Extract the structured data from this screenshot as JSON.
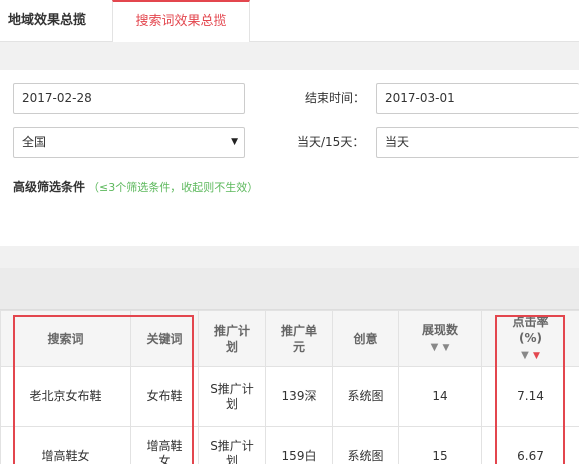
{
  "tabs": [
    {
      "label": "地域效果总揽"
    },
    {
      "label": "搜索词效果总揽"
    }
  ],
  "form": {
    "start_date": "2017-02-28",
    "end_label": "结束时间：",
    "end_date": "2017-03-01",
    "region": "全国",
    "day_label": "当天/15天：",
    "day_value": "当天",
    "advanced_title": "高级筛选条件",
    "advanced_hint": "（≤3个筛选条件，收起则不生效）"
  },
  "table": {
    "headers": [
      "搜索词",
      "关键词",
      "推广计划",
      "推广单元",
      "创意",
      "展现数",
      "点击率(%)"
    ],
    "rows": [
      {
        "query": "老北京女布鞋",
        "keyword": "女布鞋",
        "plan": "S推广计划",
        "unit": "139深",
        "creative": "系统图",
        "impressions": "14",
        "ctr": "7.14"
      },
      {
        "query": "增高鞋女",
        "keyword": "增高鞋女",
        "plan": "S推广计划",
        "unit": "159白",
        "creative": "系统图",
        "impressions": "15",
        "ctr": "6.67"
      }
    ]
  },
  "colors": {
    "accent": "#e3464e",
    "hint": "#5cb85c",
    "header_bg": "#f5f5f5"
  }
}
